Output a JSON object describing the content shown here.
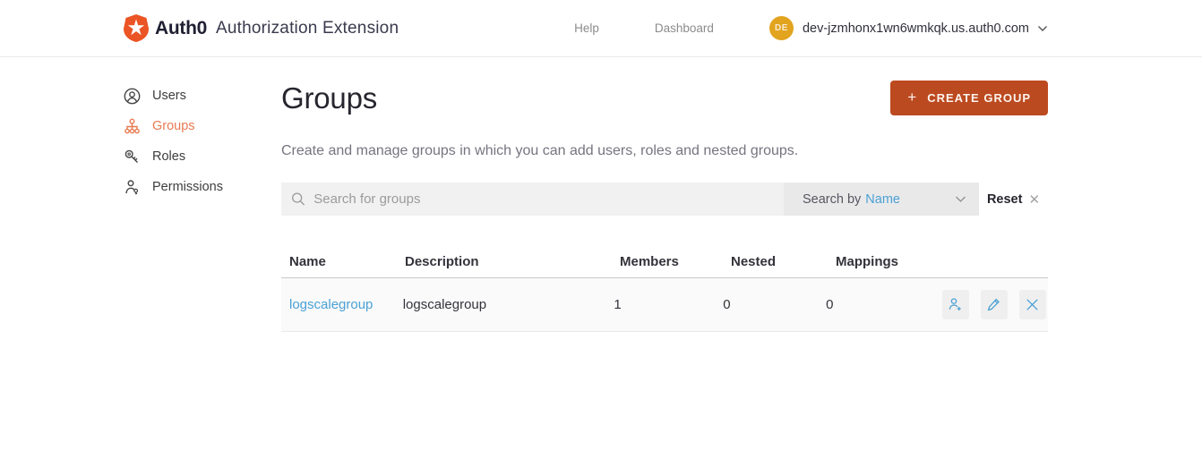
{
  "header": {
    "brand": "Auth0",
    "app_title": "Authorization Extension",
    "nav": [
      {
        "label": "Help"
      },
      {
        "label": "Dashboard"
      }
    ],
    "user": {
      "initials": "DE",
      "domain": "dev-jzmhonx1wn6wmkqk.us.auth0.com"
    }
  },
  "sidebar": {
    "items": [
      {
        "label": "Users",
        "icon": "user-circle-icon",
        "active": false
      },
      {
        "label": "Groups",
        "icon": "org-hierarchy-icon",
        "active": true
      },
      {
        "label": "Roles",
        "icon": "key-icon",
        "active": false
      },
      {
        "label": "Permissions",
        "icon": "person-key-icon",
        "active": false
      }
    ]
  },
  "main": {
    "title": "Groups",
    "description": "Create and manage groups in which you can add users, roles and nested groups.",
    "create_button": "CREATE GROUP",
    "search": {
      "placeholder": "Search for groups",
      "search_by_label": "Search by",
      "search_by_value": "Name",
      "reset_label": "Reset"
    },
    "table": {
      "columns": [
        "Name",
        "Description",
        "Members",
        "Nested",
        "Mappings"
      ],
      "rows": [
        {
          "name": "logscalegroup",
          "description": "logscalegroup",
          "members": "1",
          "nested": "0",
          "mappings": "0",
          "actions": [
            "add-member-icon",
            "edit-pencil-icon",
            "delete-x-icon"
          ]
        }
      ]
    }
  },
  "colors": {
    "logo_orange": "#eb5424",
    "button_orange": "#bc4a20",
    "active_nav_orange": "#e87a52",
    "link_blue": "#4ba0d4",
    "avatar_amber": "#e2a41f"
  }
}
